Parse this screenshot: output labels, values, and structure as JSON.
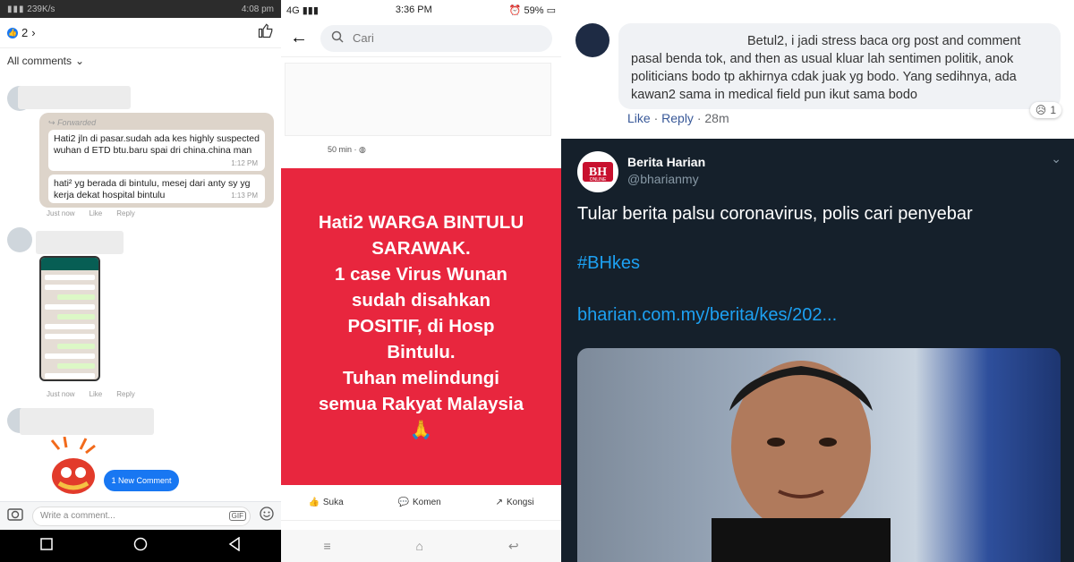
{
  "panel1": {
    "status": {
      "signal": "all",
      "speed": "239K/s",
      "time": "4:08 pm"
    },
    "reactions": {
      "count": "2"
    },
    "filter_label": "All comments",
    "chat": {
      "forwarded_label": "Forwarded",
      "msg1": "Hati2 jln di pasar.sudah ada kes highly suspected wuhan d ETD btu.baru spai dri china.china man",
      "msg1_time": "1:12 PM",
      "msg2": "hati² yg berada di bintulu, mesej dari anty sy yg kerja dekat hospital bintulu",
      "msg2_time": "1:13 PM"
    },
    "comment_meta": {
      "time": "Just now",
      "like": "Like",
      "reply": "Reply"
    },
    "new_comment": "1 New Comment",
    "write_placeholder": "Write a comment...",
    "gif_label": "GIF"
  },
  "panel2": {
    "status": {
      "network": "4G",
      "time": "3:36 PM",
      "battery": "59%"
    },
    "search_placeholder": "Cari",
    "post_time": "50 min",
    "post_lines": [
      "Hati2 WARGA BINTULU",
      "SARAWAK.",
      "1 case Virus Wunan",
      "sudah disahkan",
      "POSITIF, di Hosp",
      "Bintulu.",
      "Tuhan melindungi",
      "semua Rakyat Malaysia"
    ],
    "post_emoji": "🙏",
    "actions": {
      "like": "Suka",
      "comment": "Komen",
      "share": "Kongsi"
    }
  },
  "panel3": {
    "comment": {
      "line1": "Betul2, i jadi stress baca org post and comment",
      "line2": "pasal benda tok, and then as usual kluar lah sentimen politik, anok",
      "line3": "politicians bodo tp akhirnya cdak juak yg bodo. Yang sedihnya, ada",
      "line4": "kawan2 sama in medical field pun ikut sama bodo",
      "like": "Like",
      "reply": "Reply",
      "time": "28m",
      "reaction_count": "1"
    },
    "tweet": {
      "name": "Berita Harian",
      "handle": "@bharianmy",
      "logo_text": "BH",
      "logo_sub": "ONLINE",
      "text": "Tular berita palsu coronavirus, polis cari penyebar",
      "hashtag": "#BHkes",
      "link": "bharian.com.my/berita/kes/202..."
    }
  }
}
